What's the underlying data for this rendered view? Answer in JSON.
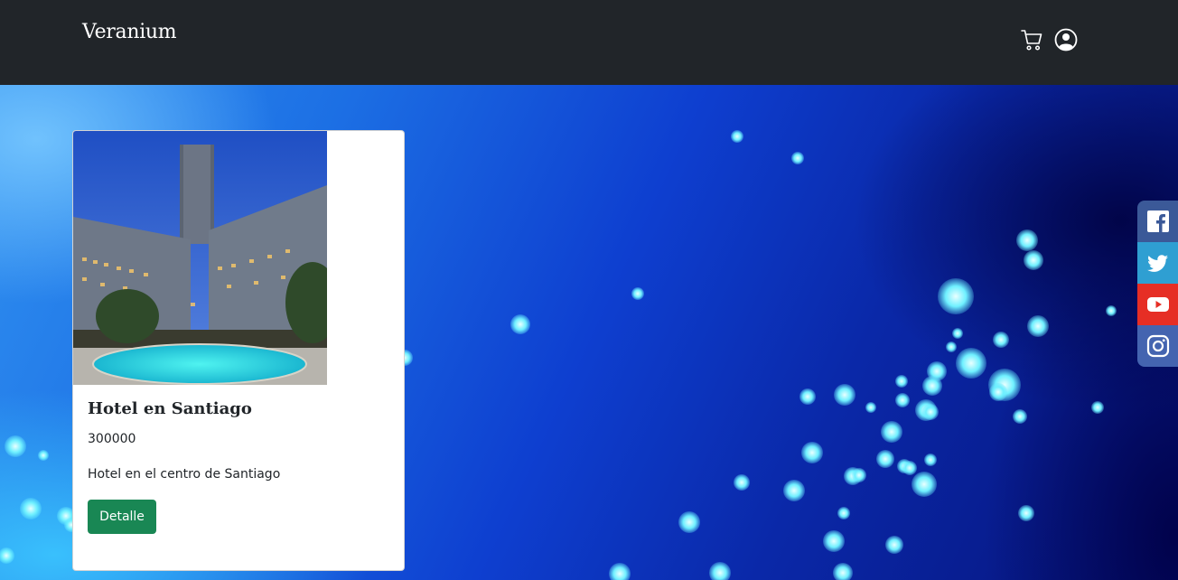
{
  "navbar": {
    "brand": "Veranium",
    "icons": [
      "cart-icon",
      "user-circle-icon"
    ]
  },
  "product_card": {
    "title": "Hotel en Santiago",
    "price": "300000",
    "description": "Hotel en el centro de Santiago",
    "button_label": "Detalle"
  },
  "social_bar": {
    "items": [
      {
        "name": "facebook",
        "icon": "facebook-icon",
        "color": "#3b5998"
      },
      {
        "name": "twitter",
        "icon": "twitter-icon",
        "color": "#2f9fd2"
      },
      {
        "name": "youtube",
        "icon": "youtube-icon",
        "color": "#e62e25"
      },
      {
        "name": "instagram",
        "icon": "instagram-icon",
        "color": "#4464b0"
      }
    ]
  },
  "colors": {
    "navbar_bg": "#212529",
    "button_success": "#198754"
  }
}
